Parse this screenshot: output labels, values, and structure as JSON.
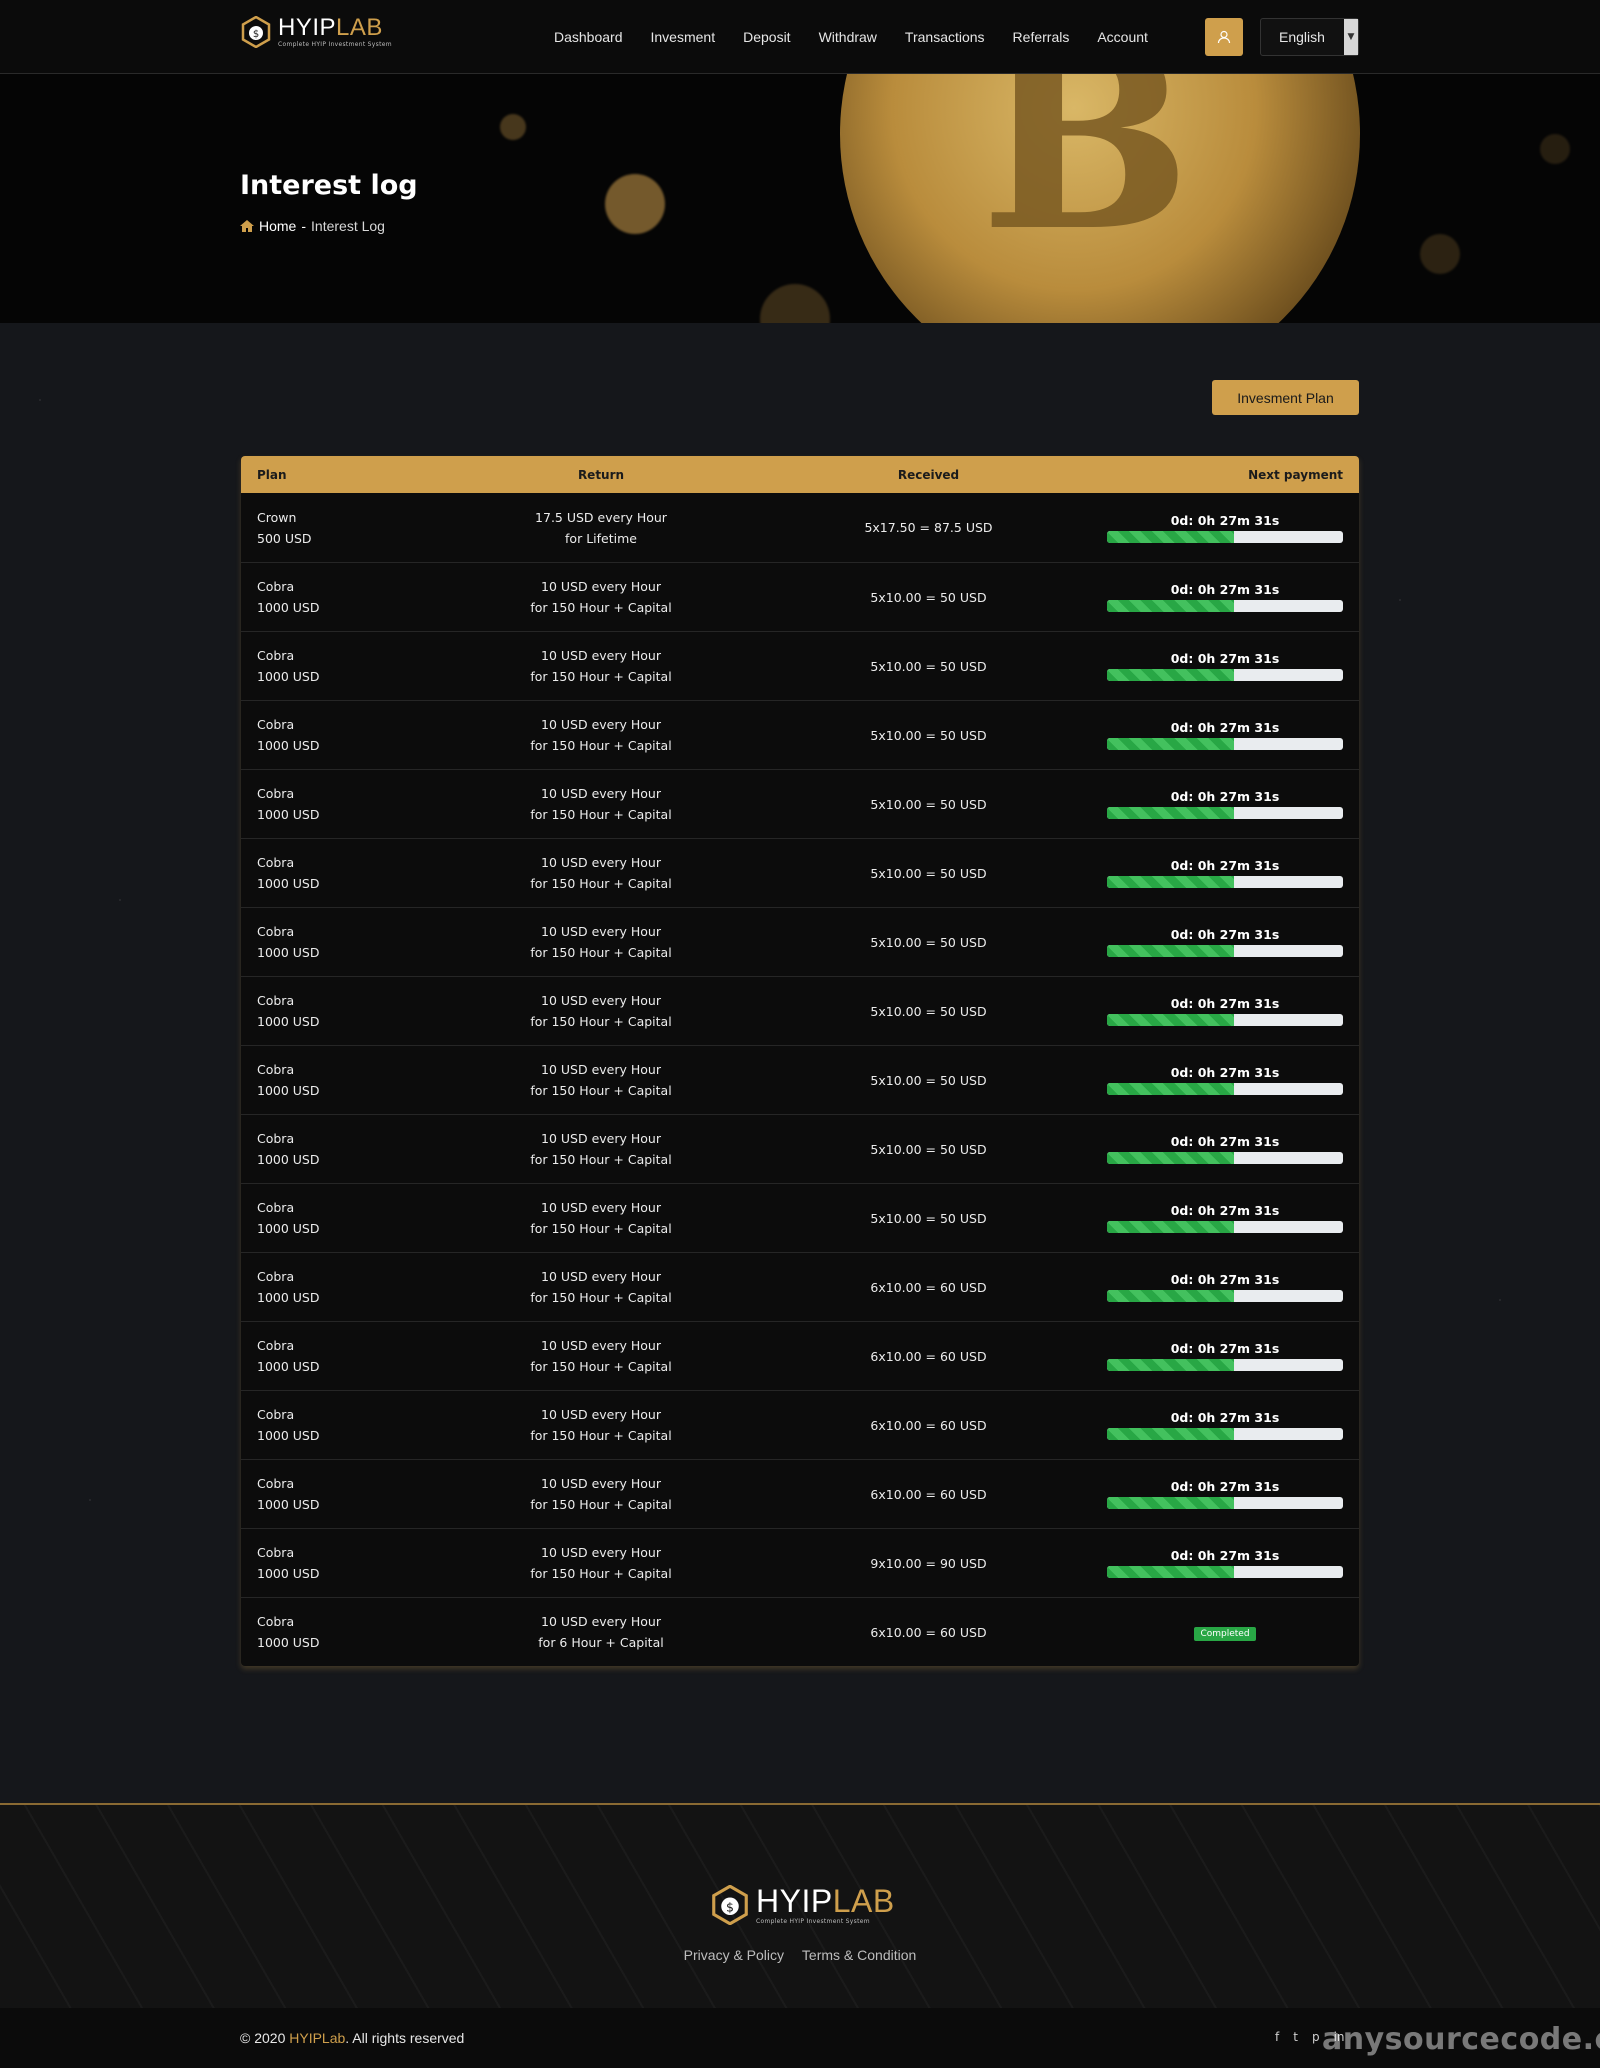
{
  "brand": {
    "part1": "HYIP",
    "part2": "LAB",
    "tagline": "Complete HYIP Investment System"
  },
  "nav": {
    "items": [
      "Dashboard",
      "Invesment",
      "Deposit",
      "Withdraw",
      "Transactions",
      "Referrals",
      "Account"
    ]
  },
  "language": {
    "selected": "English"
  },
  "hero": {
    "title": "Interest log",
    "breadcrumb_home": "Home",
    "breadcrumb_sep": "-",
    "breadcrumb_current": "Interest Log"
  },
  "actions": {
    "plan_button": "Invesment Plan"
  },
  "table": {
    "headers": [
      "Plan",
      "Return",
      "Received",
      "Next payment"
    ],
    "rows": [
      {
        "plan": "Crown",
        "amount": "500 USD",
        "return1": "17.5 USD every Hour",
        "return2": "for Lifetime",
        "received": "5x17.50 = 87.5 USD",
        "next": "0d: 0h 27m 31s",
        "progress": 0.54
      },
      {
        "plan": "Cobra",
        "amount": "1000 USD",
        "return1": "10 USD every Hour",
        "return2": "for 150 Hour + Capital",
        "received": "5x10.00 = 50 USD",
        "next": "0d: 0h 27m 31s",
        "progress": 0.54
      },
      {
        "plan": "Cobra",
        "amount": "1000 USD",
        "return1": "10 USD every Hour",
        "return2": "for 150 Hour + Capital",
        "received": "5x10.00 = 50 USD",
        "next": "0d: 0h 27m 31s",
        "progress": 0.54
      },
      {
        "plan": "Cobra",
        "amount": "1000 USD",
        "return1": "10 USD every Hour",
        "return2": "for 150 Hour + Capital",
        "received": "5x10.00 = 50 USD",
        "next": "0d: 0h 27m 31s",
        "progress": 0.54
      },
      {
        "plan": "Cobra",
        "amount": "1000 USD",
        "return1": "10 USD every Hour",
        "return2": "for 150 Hour + Capital",
        "received": "5x10.00 = 50 USD",
        "next": "0d: 0h 27m 31s",
        "progress": 0.54
      },
      {
        "plan": "Cobra",
        "amount": "1000 USD",
        "return1": "10 USD every Hour",
        "return2": "for 150 Hour + Capital",
        "received": "5x10.00 = 50 USD",
        "next": "0d: 0h 27m 31s",
        "progress": 0.54
      },
      {
        "plan": "Cobra",
        "amount": "1000 USD",
        "return1": "10 USD every Hour",
        "return2": "for 150 Hour + Capital",
        "received": "5x10.00 = 50 USD",
        "next": "0d: 0h 27m 31s",
        "progress": 0.54
      },
      {
        "plan": "Cobra",
        "amount": "1000 USD",
        "return1": "10 USD every Hour",
        "return2": "for 150 Hour + Capital",
        "received": "5x10.00 = 50 USD",
        "next": "0d: 0h 27m 31s",
        "progress": 0.54
      },
      {
        "plan": "Cobra",
        "amount": "1000 USD",
        "return1": "10 USD every Hour",
        "return2": "for 150 Hour + Capital",
        "received": "5x10.00 = 50 USD",
        "next": "0d: 0h 27m 31s",
        "progress": 0.54
      },
      {
        "plan": "Cobra",
        "amount": "1000 USD",
        "return1": "10 USD every Hour",
        "return2": "for 150 Hour + Capital",
        "received": "5x10.00 = 50 USD",
        "next": "0d: 0h 27m 31s",
        "progress": 0.54
      },
      {
        "plan": "Cobra",
        "amount": "1000 USD",
        "return1": "10 USD every Hour",
        "return2": "for 150 Hour + Capital",
        "received": "5x10.00 = 50 USD",
        "next": "0d: 0h 27m 31s",
        "progress": 0.54
      },
      {
        "plan": "Cobra",
        "amount": "1000 USD",
        "return1": "10 USD every Hour",
        "return2": "for 150 Hour + Capital",
        "received": "6x10.00 = 60 USD",
        "next": "0d: 0h 27m 31s",
        "progress": 0.54
      },
      {
        "plan": "Cobra",
        "amount": "1000 USD",
        "return1": "10 USD every Hour",
        "return2": "for 150 Hour + Capital",
        "received": "6x10.00 = 60 USD",
        "next": "0d: 0h 27m 31s",
        "progress": 0.54
      },
      {
        "plan": "Cobra",
        "amount": "1000 USD",
        "return1": "10 USD every Hour",
        "return2": "for 150 Hour + Capital",
        "received": "6x10.00 = 60 USD",
        "next": "0d: 0h 27m 31s",
        "progress": 0.54
      },
      {
        "plan": "Cobra",
        "amount": "1000 USD",
        "return1": "10 USD every Hour",
        "return2": "for 150 Hour + Capital",
        "received": "6x10.00 = 60 USD",
        "next": "0d: 0h 27m 31s",
        "progress": 0.54
      },
      {
        "plan": "Cobra",
        "amount": "1000 USD",
        "return1": "10 USD every Hour",
        "return2": "for 150 Hour + Capital",
        "received": "9x10.00 = 90 USD",
        "next": "0d: 0h 27m 31s",
        "progress": 0.54
      },
      {
        "plan": "Cobra",
        "amount": "1000 USD",
        "return1": "10 USD every Hour",
        "return2": "for 6 Hour + Capital",
        "received": "6x10.00 = 60 USD",
        "status": "Completed"
      }
    ]
  },
  "footer": {
    "links": [
      "Privacy & Policy",
      "Terms & Condition"
    ],
    "copy_prefix": "© 2020",
    "copy_brand": "HYIPLab",
    "copy_suffix": ". All rights reserved",
    "watermark": "anysourcecode.com"
  },
  "colors": {
    "accent": "#cf9f4c",
    "progress": "#28a745",
    "background": "#15171b"
  },
  "icons": {
    "user": "user-icon",
    "home": "home-icon",
    "social": [
      "facebook-icon",
      "twitter-icon",
      "pinterest-icon",
      "linkedin-icon"
    ]
  }
}
